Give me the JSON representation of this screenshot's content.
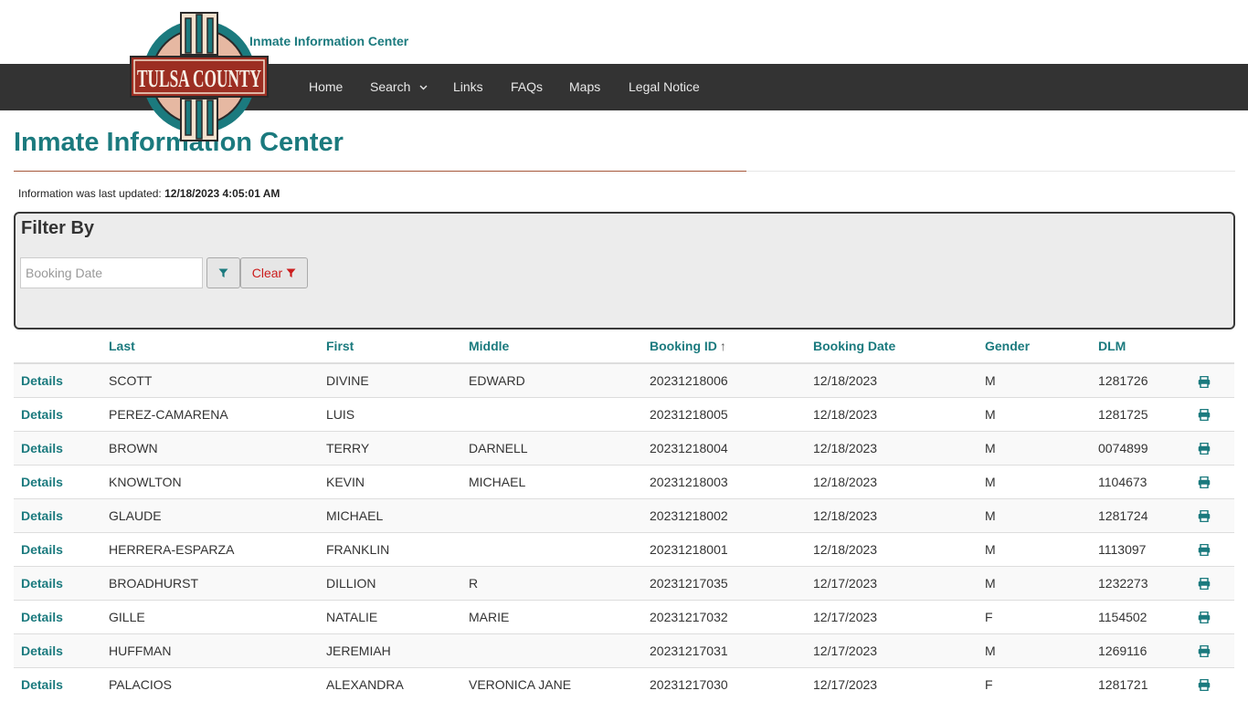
{
  "header": {
    "site_title": "Inmate Information Center",
    "logo_text": "TULSA COUNTY"
  },
  "nav": {
    "items": [
      {
        "label": "Home"
      },
      {
        "label": "Search"
      },
      {
        "label": "Links"
      },
      {
        "label": "FAQs"
      },
      {
        "label": "Maps"
      },
      {
        "label": "Legal Notice"
      }
    ]
  },
  "page": {
    "title": "Inmate Information Center",
    "updated_label": "Information was last updated:",
    "updated_value": "12/18/2023 4:05:01 AM"
  },
  "filter": {
    "title": "Filter By",
    "date_placeholder": "Booking Date",
    "clear_label": "Clear"
  },
  "table": {
    "headers": {
      "details": "",
      "last": "Last",
      "first": "First",
      "middle": "Middle",
      "booking_id": "Booking ID",
      "sort_indicator": "↑",
      "booking_date": "Booking Date",
      "gender": "Gender",
      "dlm": "DLM"
    },
    "details_label": "Details",
    "rows": [
      {
        "last": "SCOTT",
        "first": "DIVINE",
        "middle": "EDWARD",
        "booking_id": "20231218006",
        "booking_date": "12/18/2023",
        "gender": "M",
        "dlm": "1281726"
      },
      {
        "last": "PEREZ-CAMARENA",
        "first": "LUIS",
        "middle": "",
        "booking_id": "20231218005",
        "booking_date": "12/18/2023",
        "gender": "M",
        "dlm": "1281725"
      },
      {
        "last": "BROWN",
        "first": "TERRY",
        "middle": "DARNELL",
        "booking_id": "20231218004",
        "booking_date": "12/18/2023",
        "gender": "M",
        "dlm": "0074899"
      },
      {
        "last": "KNOWLTON",
        "first": "KEVIN",
        "middle": "MICHAEL",
        "booking_id": "20231218003",
        "booking_date": "12/18/2023",
        "gender": "M",
        "dlm": "1104673"
      },
      {
        "last": "GLAUDE",
        "first": "MICHAEL",
        "middle": "",
        "booking_id": "20231218002",
        "booking_date": "12/18/2023",
        "gender": "M",
        "dlm": "1281724"
      },
      {
        "last": "HERRERA-ESPARZA",
        "first": "FRANKLIN",
        "middle": "",
        "booking_id": "20231218001",
        "booking_date": "12/18/2023",
        "gender": "M",
        "dlm": "1113097"
      },
      {
        "last": "BROADHURST",
        "first": "DILLION",
        "middle": "R",
        "booking_id": "20231217035",
        "booking_date": "12/17/2023",
        "gender": "M",
        "dlm": "1232273"
      },
      {
        "last": "GILLE",
        "first": "NATALIE",
        "middle": "MARIE",
        "booking_id": "20231217032",
        "booking_date": "12/17/2023",
        "gender": "F",
        "dlm": "1154502"
      },
      {
        "last": "HUFFMAN",
        "first": "JEREMIAH",
        "middle": "",
        "booking_id": "20231217031",
        "booking_date": "12/17/2023",
        "gender": "M",
        "dlm": "1269116"
      },
      {
        "last": "PALACIOS",
        "first": "ALEXANDRA",
        "middle": "VERONICA JANE",
        "booking_id": "20231217030",
        "booking_date": "12/17/2023",
        "gender": "F",
        "dlm": "1281721"
      }
    ]
  },
  "colors": {
    "accent": "#1b7a7e",
    "navbar": "#333333",
    "rule": "#a5573a",
    "clear": "#cc1d1d"
  },
  "icons": {
    "filter": "filter-icon",
    "print": "print-icon",
    "chevron": "chevron-down-icon"
  }
}
